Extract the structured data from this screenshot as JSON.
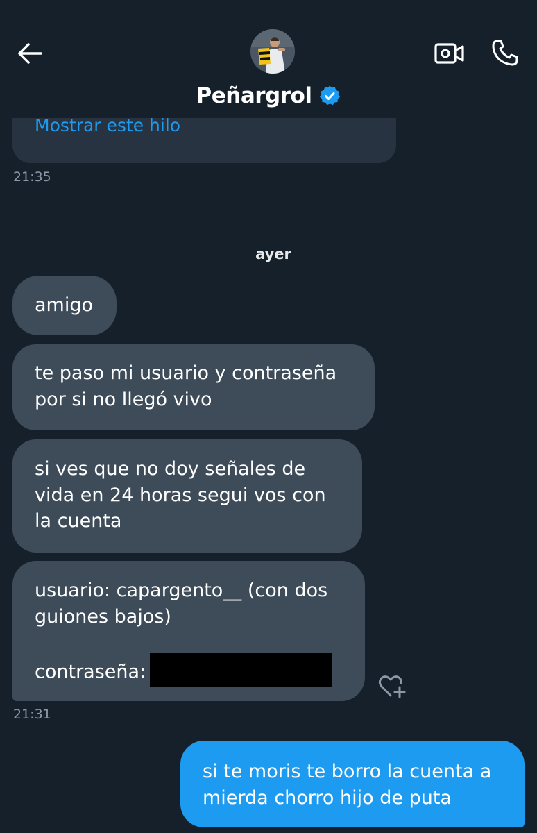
{
  "header": {
    "contact_name": "Peñargrol",
    "back_icon": "arrow-left-icon",
    "verified_icon": "verified-badge-icon",
    "video_icon": "video-call-icon",
    "phone_icon": "phone-call-icon"
  },
  "thread": {
    "link_text": "Mostrar este hilo",
    "timestamp": "21:35"
  },
  "day_separator": "ayer",
  "messages_in": [
    {
      "lines": [
        "amigo"
      ]
    },
    {
      "lines": [
        "te paso mi usuario y contraseña",
        "por si no llegó vivo"
      ]
    },
    {
      "lines": [
        "si ves que no doy señales de",
        "vida en 24 horas segui vos con",
        "la cuenta"
      ]
    },
    {
      "lines": [
        "usuario: capargento__ (con dos",
        "guiones bajos)",
        "",
        "contraseña:"
      ]
    }
  ],
  "incoming_timestamp": "21:31",
  "messages_out": [
    {
      "lines": [
        "si te moris te borro la cuenta a",
        "mierda chorro hijo de puta"
      ]
    }
  ],
  "colors": {
    "background": "#15202b",
    "bubble_in": "#3e4c5a",
    "bubble_out": "#1d9bf0",
    "link": "#1d9bf0",
    "timestamp": "#8b98a5"
  }
}
